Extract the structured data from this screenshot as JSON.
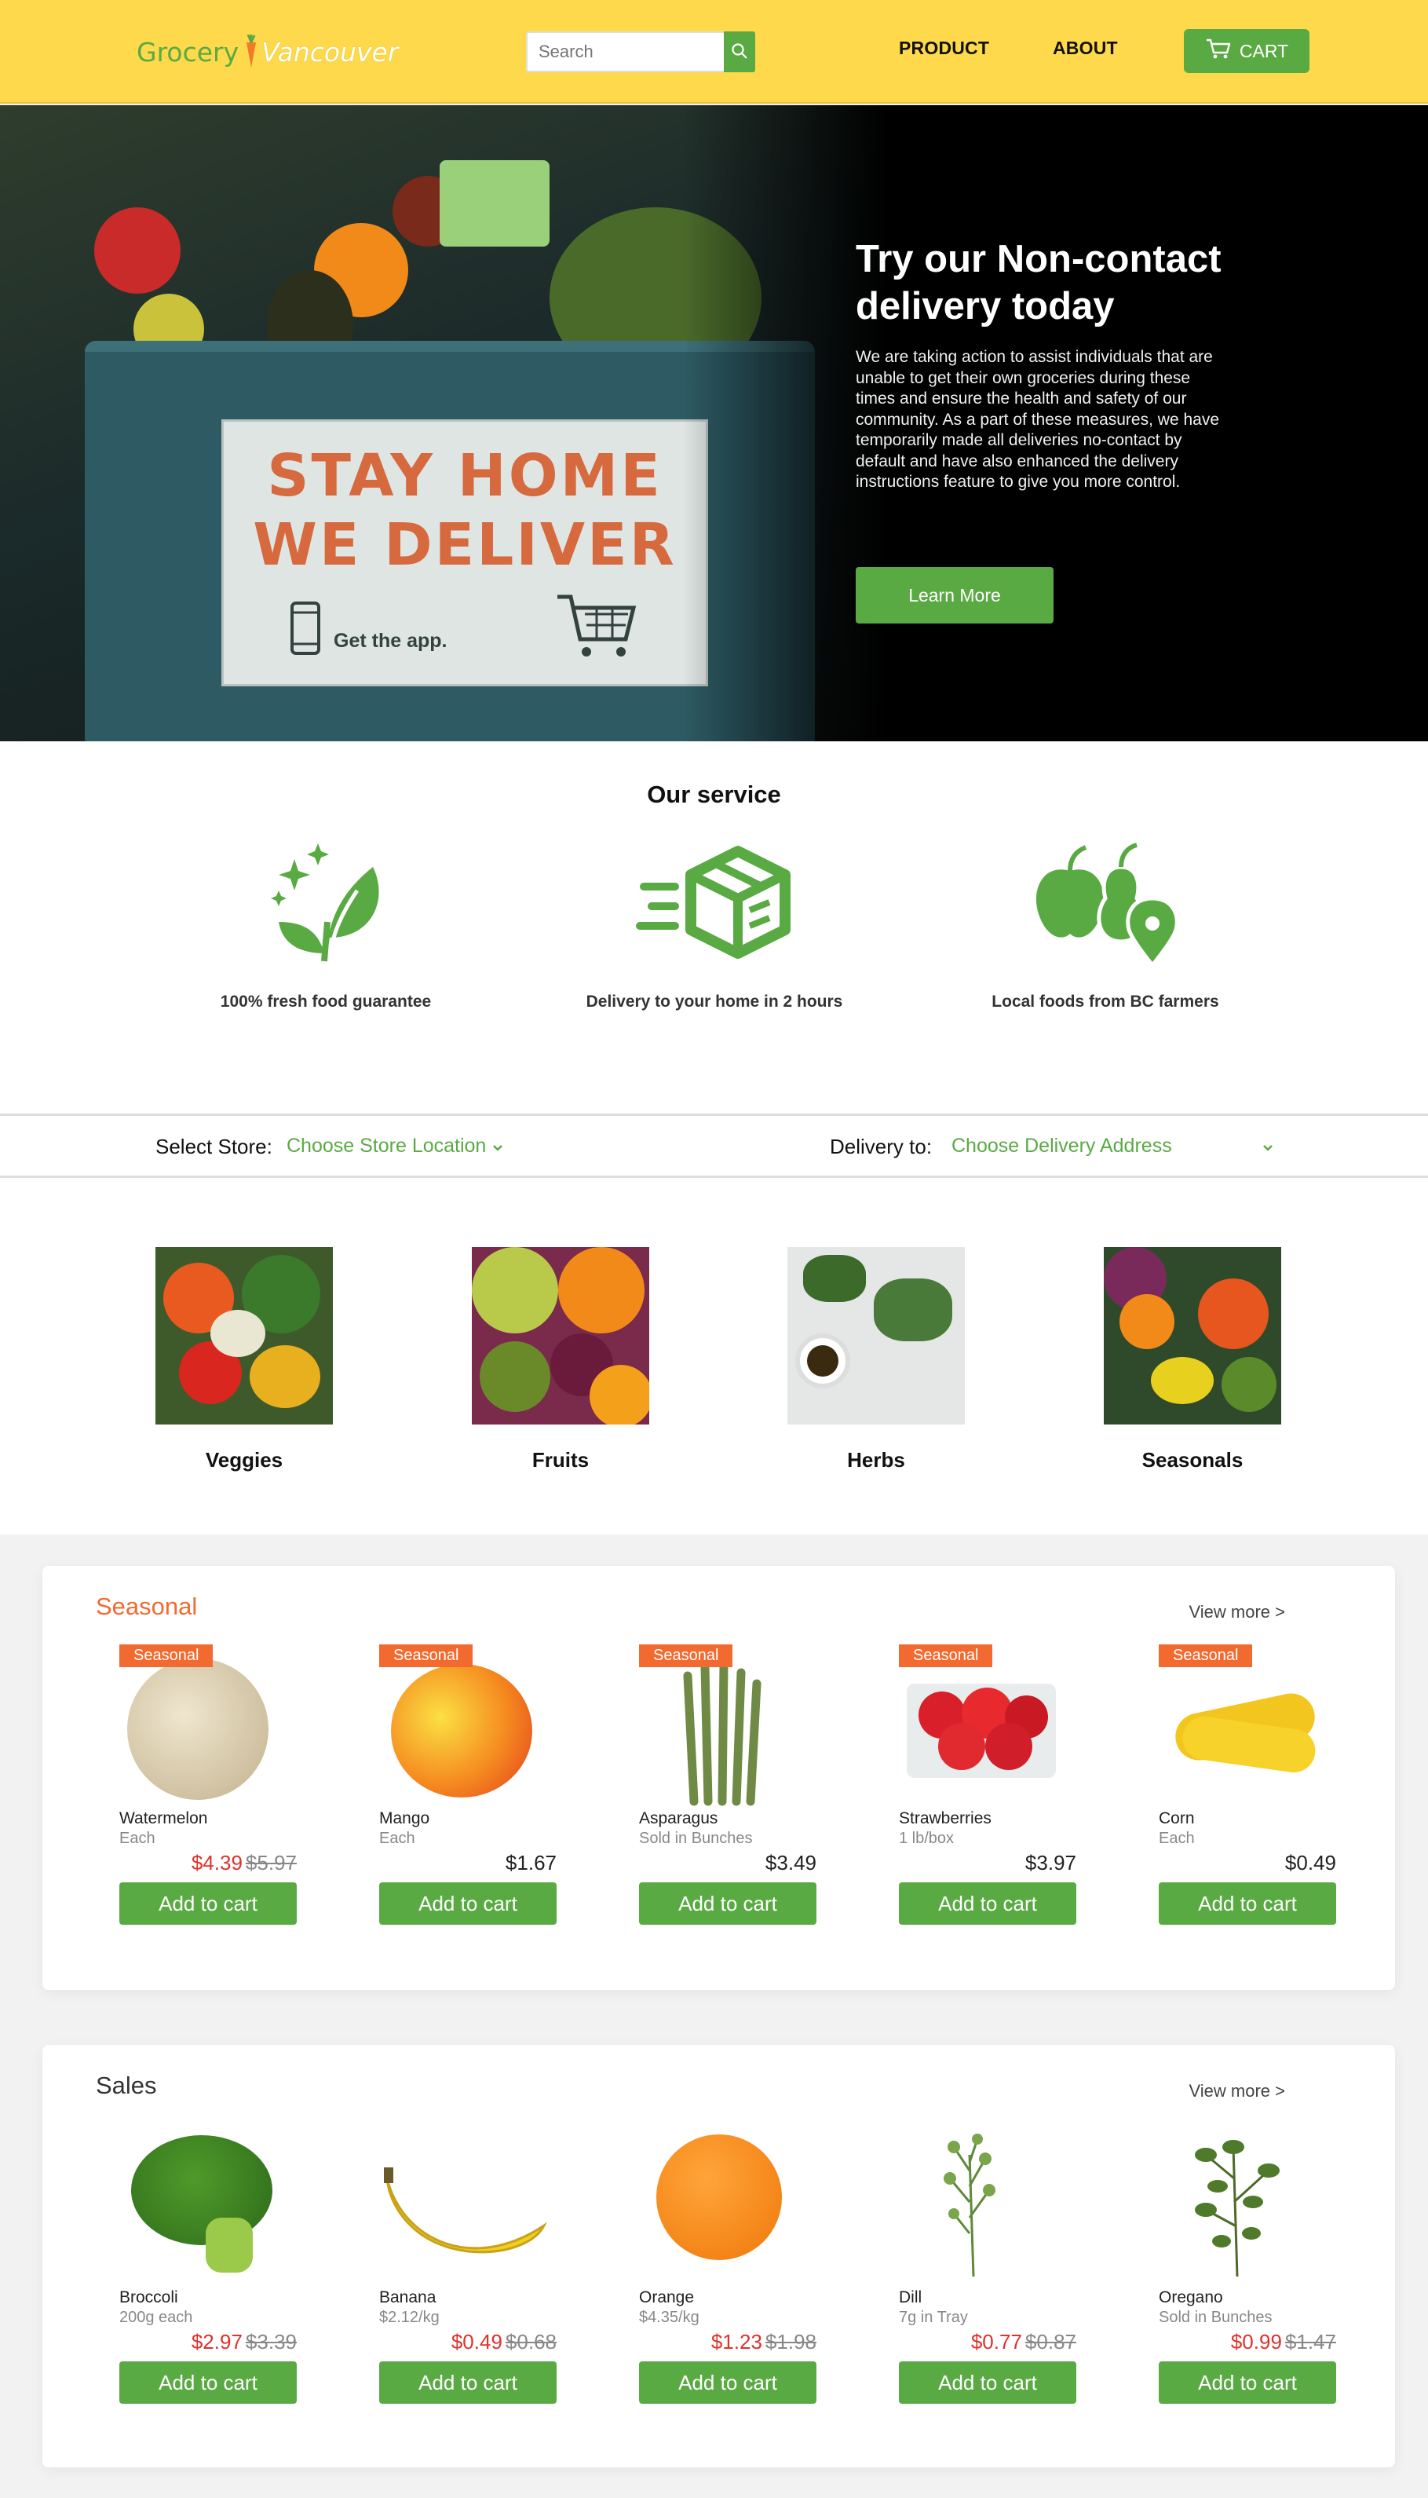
{
  "header": {
    "logo_word": "Grocery",
    "logo_city": "Vancouver",
    "search_placeholder": "Search",
    "nav": [
      "PRODUCT",
      "ABOUT"
    ],
    "cart_label": "CART"
  },
  "hero": {
    "sign_line1": "STAY HOME",
    "sign_line2": "WE DELIVER",
    "sign_app": "Get the app.",
    "title": "Try our Non-contact delivery today",
    "body": "We are taking action to assist individuals that are unable to get their own groceries during these times and ensure the health and safety of our community. As a part of these measures, we have temporarily made all deliveries no-contact by default and have also enhanced the delivery instructions feature to give you more control.",
    "button": "Learn More"
  },
  "service": {
    "title": "Our service",
    "items": [
      {
        "icon": "fresh-leaf-icon",
        "label": "100% fresh food guarantee"
      },
      {
        "icon": "delivery-box-icon",
        "label": "Delivery to your home in 2 hours"
      },
      {
        "icon": "local-produce-pin-icon",
        "label": "Local foods from BC farmers"
      }
    ]
  },
  "selectors": {
    "store_label": "Select Store:",
    "store_value": "Choose Store Location",
    "delivery_label": "Delivery to:",
    "delivery_value": "Choose Delivery Address"
  },
  "categories": [
    "Veggies",
    "Fruits",
    "Herbs",
    "Seasonals"
  ],
  "seasonal": {
    "title": "Seasonal",
    "view_more": "View more >",
    "badge": "Seasonal",
    "products": [
      {
        "name": "Watermelon",
        "unit": "Each",
        "price": "$4.39",
        "old_price": "$5.97",
        "on_sale": true
      },
      {
        "name": "Mango",
        "unit": "Each",
        "price": "$1.67",
        "old_price": "",
        "on_sale": false
      },
      {
        "name": "Asparagus",
        "unit": "Sold in Bunches",
        "price": "$3.49",
        "old_price": "",
        "on_sale": false
      },
      {
        "name": "Strawberries",
        "unit": "1 lb/box",
        "price": "$3.97",
        "old_price": "",
        "on_sale": false
      },
      {
        "name": "Corn",
        "unit": "Each",
        "price": "$0.49",
        "old_price": "",
        "on_sale": false
      }
    ]
  },
  "sales": {
    "title": "Sales",
    "view_more": "View more >",
    "products": [
      {
        "name": "Broccoli",
        "unit": "200g each",
        "price": "$2.97",
        "old_price": "$3.39",
        "on_sale": true
      },
      {
        "name": "Banana",
        "unit": "$2.12/kg",
        "price": "$0.49",
        "old_price": "$0.68",
        "on_sale": true
      },
      {
        "name": "Orange",
        "unit": "$4.35/kg",
        "price": "$1.23",
        "old_price": "$1.98",
        "on_sale": true
      },
      {
        "name": "Dill",
        "unit": "7g in Tray",
        "price": "$0.77",
        "old_price": "$0.87",
        "on_sale": true
      },
      {
        "name": "Oregano",
        "unit": "Sold in Bunches",
        "price": "$0.99",
        "old_price": "$1.47",
        "on_sale": true
      }
    ]
  },
  "add_to_cart": "Add to cart",
  "colors": {
    "header": "#fdd94b",
    "accent": "#5aaa44",
    "seasonal_title": "#f26a2f",
    "sale_price": "#e0312b",
    "hero_bg": "#000000"
  }
}
